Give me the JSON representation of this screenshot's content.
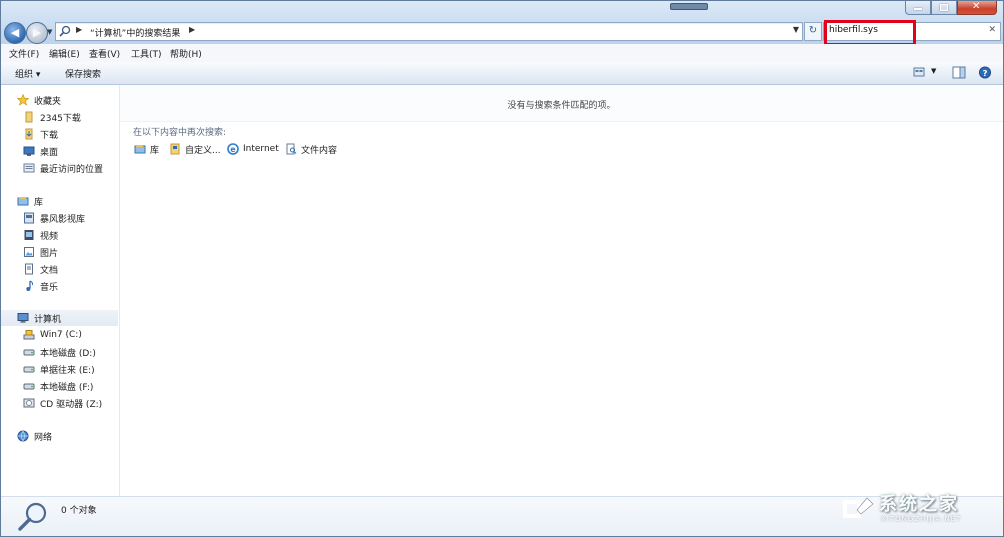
{
  "window": {
    "address": {
      "path": "“计算机”中的搜索结果"
    },
    "search": {
      "value": "hiberfil.sys"
    }
  },
  "menubar": {
    "items": [
      "文件(F)",
      "编辑(E)",
      "查看(V)",
      "工具(T)",
      "帮助(H)"
    ]
  },
  "commandbar": {
    "organize": "组织 ▾",
    "save_search": "保存搜索"
  },
  "navpane": {
    "favorites": {
      "label": "收藏夹",
      "items": [
        "2345下载",
        "下载",
        "桌面",
        "最近访问的位置"
      ]
    },
    "libraries": {
      "label": "库",
      "items": [
        "暴风影视库",
        "视频",
        "图片",
        "文档",
        "音乐"
      ]
    },
    "computer": {
      "label": "计算机",
      "items": [
        "Win7 (C:)",
        "本地磁盘 (D:)",
        "单据往来 (E:)",
        "本地磁盘 (F:)",
        "CD 驱动器 (Z:)"
      ]
    },
    "network": {
      "label": "网络"
    }
  },
  "content": {
    "no_results": "没有与搜索条件匹配的项。",
    "search_again_label": "在以下内容中再次搜索:",
    "locations": [
      "库",
      "自定义...",
      "Internet",
      "文件内容"
    ]
  },
  "status": {
    "count": "0 个对象"
  },
  "watermark": {
    "text": "系统之家",
    "sub": "XITONGZHIJIA.NET"
  },
  "colors": {
    "highlight": "#e3001b",
    "accent": "#2e6bb5"
  }
}
